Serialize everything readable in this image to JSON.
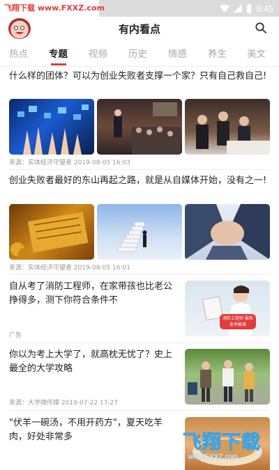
{
  "status_bar": {
    "watermark_text": "飞翔下载 www.FXXZ.com",
    "time": "9:45"
  },
  "app_bar": {
    "title": "有内看点",
    "avatar_icon": "cartoon-face-avatar",
    "search_icon": "search-icon"
  },
  "tabs": [
    {
      "label": "热点",
      "active": false
    },
    {
      "label": "专题",
      "active": true
    },
    {
      "label": "视频",
      "active": false
    },
    {
      "label": "历史",
      "active": false
    },
    {
      "label": "情感",
      "active": false
    },
    {
      "label": "养生",
      "active": false
    },
    {
      "label": "美文",
      "active": false
    }
  ],
  "accent_color": "#e23b3b",
  "articles": [
    {
      "title": "什么样的团体？可以为创业失败者支撑一个家？只有自己救自己!",
      "meta": "来源：实体经济守望者   2019-08-05 16:03"
    },
    {
      "title": "创业失败者最好的东山再起之路，就是从自媒体开始，没有之一!",
      "meta": "来源：实体经济守望者   2019-08-05 16:01"
    },
    {
      "title": "自从考了消防工程师，在家带孩也比老公挣得多，测下你符合条件不",
      "meta": "广告",
      "image_caption": "消防工程师 报名条件解读"
    },
    {
      "title": "你以为考上大学了，就高枕无忧了？史上最全的大学攻略",
      "meta": "来源：大学微传媒   2019-07-22 17:27"
    },
    {
      "title": "\"伏羊一碗汤，不用开药方\"，夏天吃羊肉，好处非常多",
      "meta": ""
    }
  ],
  "bottom_watermark": {
    "brand": "飞翔下载",
    "url": "www.FXXZ.com"
  }
}
